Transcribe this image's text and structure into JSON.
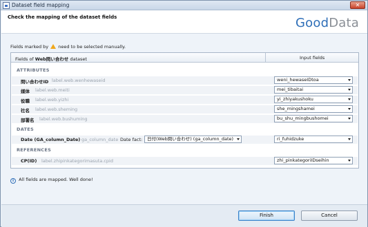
{
  "window": {
    "title": "Dataset field mapping",
    "close_glyph": "✕"
  },
  "header": {
    "title": "Check the mapping of the dataset fields",
    "logo_part1": "Good",
    "logo_part2": "Data"
  },
  "notice": {
    "before": "Fields marked by",
    "after": "need to be selected manually."
  },
  "table": {
    "col1_prefix": "Fields of ",
    "dataset_name": "Web問い合わせ",
    "col1_suffix": " dataset",
    "col2": "Input fields"
  },
  "sections": {
    "attributes": "ATTRIBUTES",
    "dates": "DATES",
    "references": "REFERENCES"
  },
  "attributes": [
    {
      "name": "問い合わせID",
      "identifier": "label.web.wenhewaseid",
      "value": "weni_hewaseIDtoa"
    },
    {
      "name": "媒体",
      "identifier": "label.web.meiti",
      "value": "mei_tibaitai"
    },
    {
      "name": "役職",
      "identifier": "label.web.yizhi",
      "value": "yi_zhiyakushoku"
    },
    {
      "name": "社名",
      "identifier": "label.web.sheming",
      "value": "she_mingshamei"
    },
    {
      "name": "部署名",
      "identifier": "label.web.bushuming",
      "value": "bu_shu_mingbushomei"
    }
  ],
  "dates": [
    {
      "name": "Date (GA_column_Date)",
      "identifier": "ga_column_date",
      "date_fact_label": "Date fact:",
      "date_fact_value": "日付(Web問い合わせ) (ga_column_date)",
      "value": "ri_fuhidzuke"
    }
  ],
  "references": [
    {
      "name": "CP(ID)",
      "identifier": "label.zhipinkategorimasuta.cpid",
      "value": "zhi_pinkategoriIDseihin"
    }
  ],
  "status": {
    "icon": "i",
    "text": "All fields are mapped. Well done!"
  },
  "buttons": {
    "finish": "Finish",
    "cancel": "Cancel"
  }
}
